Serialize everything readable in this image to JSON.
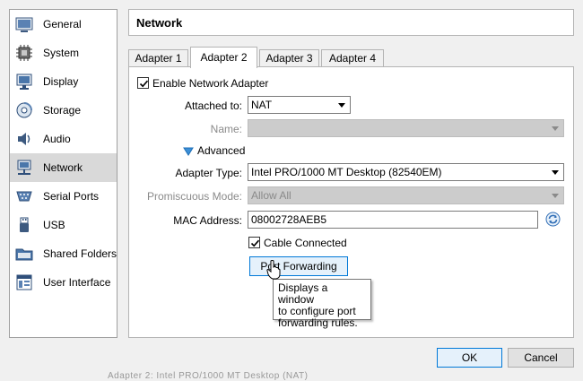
{
  "sidebar": {
    "items": [
      {
        "label": "General",
        "icon": "general-icon"
      },
      {
        "label": "System",
        "icon": "system-chip-icon"
      },
      {
        "label": "Display",
        "icon": "display-monitor-icon"
      },
      {
        "label": "Storage",
        "icon": "storage-disk-icon"
      },
      {
        "label": "Audio",
        "icon": "audio-speaker-icon"
      },
      {
        "label": "Network",
        "icon": "network-icon"
      },
      {
        "label": "Serial Ports",
        "icon": "serial-port-icon"
      },
      {
        "label": "USB",
        "icon": "usb-icon"
      },
      {
        "label": "Shared Folders",
        "icon": "shared-folder-icon"
      },
      {
        "label": "User Interface",
        "icon": "user-interface-icon"
      }
    ],
    "selected_index": 5
  },
  "header": {
    "title": "Network"
  },
  "tabs": [
    {
      "label": "Adapter 1"
    },
    {
      "label": "Adapter 2"
    },
    {
      "label": "Adapter 3"
    },
    {
      "label": "Adapter 4"
    }
  ],
  "active_tab": 1,
  "form": {
    "enable_adapter": {
      "label": "Enable Network Adapter",
      "checked": true
    },
    "attached_to": {
      "label": "Attached to:",
      "value": "NAT"
    },
    "name": {
      "label": "Name:",
      "value": ""
    },
    "advanced": {
      "label": "Advanced"
    },
    "adapter_type": {
      "label": "Adapter Type:",
      "value": "Intel PRO/1000 MT Desktop (82540EM)"
    },
    "promiscuous_mode": {
      "label": "Promiscuous Mode:",
      "value": "Allow All"
    },
    "mac_address": {
      "label": "MAC Address:",
      "value": "08002728AEB5"
    },
    "cable_connected": {
      "label": "Cable Connected",
      "checked": true
    },
    "port_forwarding": {
      "label": "Port Forwarding"
    }
  },
  "tooltip": {
    "line1": "Displays a window",
    "line2": "to configure port",
    "line3": "forwarding rules."
  },
  "footer": {
    "ok_label": "OK",
    "cancel_label": "Cancel"
  },
  "background_text": "Adapter 2: Intel PRO/1000 MT Desktop (NAT)",
  "colors": {
    "accent": "#0078d7",
    "selected_bg": "#d9d9d9",
    "disabled_bg": "#cccccc"
  }
}
